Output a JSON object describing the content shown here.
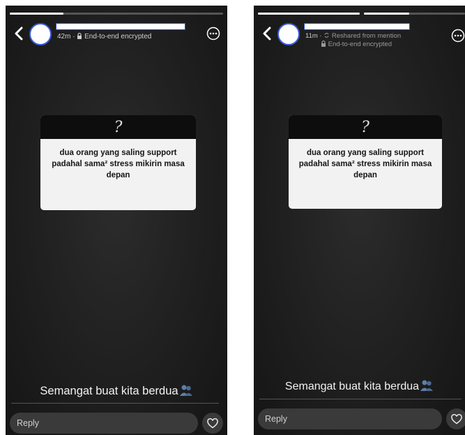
{
  "left_story": {
    "progress_fraction": 0.25,
    "time": "42m",
    "separator": "·",
    "encryption_text": "End-to-end encrypted",
    "question_mark": "?",
    "question_text": "dua orang yang saling support padahal sama² stress mikirin masa depan",
    "caption": "Semangat buat kita berdua",
    "reply_placeholder": "Reply"
  },
  "right_story": {
    "progress_fraction": 1.0,
    "second_segment_fraction": 0.45,
    "time": "11m",
    "separator": "·",
    "reshare_text": "Reshared from mention",
    "encryption_text": "End-to-end encrypted",
    "question_mark": "?",
    "question_text": "dua orang yang saling support padahal sama² stress mikirin masa depan",
    "caption": "Semangat buat kita berdua",
    "reply_placeholder": "Reply"
  },
  "icons": {
    "back": "chevron-left-icon",
    "more": "more-options-icon",
    "lock": "lock-icon",
    "reshare": "reshare-icon",
    "heart": "heart-icon",
    "emoji": "people-emoji-icon"
  },
  "colors": {
    "background": "#1f1f1f",
    "card_header": "#0d0d0d",
    "card_body": "#f2f2f2",
    "redaction_border": "#2a4fd6"
  }
}
